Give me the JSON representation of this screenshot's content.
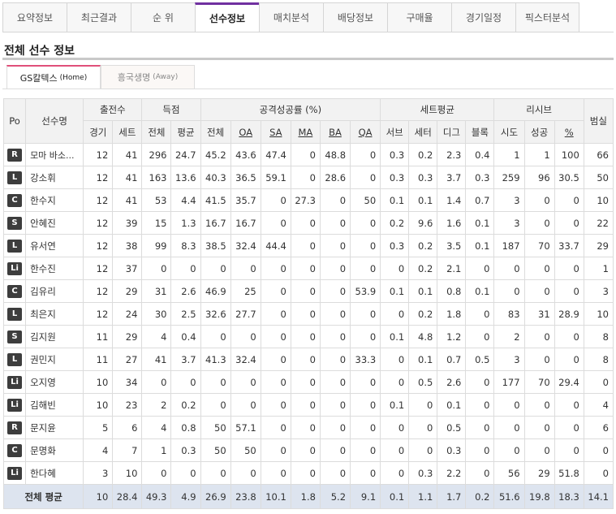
{
  "nav": {
    "tabs": [
      "요약정보",
      "최근결과",
      "순 위",
      "선수정보",
      "매치분석",
      "배당정보",
      "구매율",
      "경기일정",
      "픽스터분석"
    ],
    "active_index": 3
  },
  "section_title": "전체 선수 정보",
  "team_tabs": [
    {
      "name": "GS칼텍스",
      "side": "(Home)"
    },
    {
      "name": "흥국생명",
      "side": "(Away)"
    }
  ],
  "table": {
    "header_groups": {
      "po": "Po",
      "name": "선수명",
      "appear": "출전수",
      "score": "득점",
      "attack": "공격성공률 (%)",
      "set_avg": "세트평균",
      "receive": "리시브",
      "fault": "범실"
    },
    "sub_headers": [
      "경기",
      "세트",
      "전체",
      "평균",
      "전체",
      "OA",
      "SA",
      "MA",
      "BA",
      "QA",
      "서브",
      "세터",
      "디그",
      "블록",
      "시도",
      "성공",
      "%"
    ],
    "rows": [
      [
        "R",
        "모마 바소...",
        "12",
        "41",
        "296",
        "24.7",
        "45.2",
        "43.6",
        "47.4",
        "0",
        "48.8",
        "0",
        "0.3",
        "0.2",
        "2.3",
        "0.4",
        "1",
        "1",
        "100",
        "66"
      ],
      [
        "L",
        "강소휘",
        "12",
        "41",
        "163",
        "13.6",
        "40.3",
        "36.5",
        "59.1",
        "0",
        "28.6",
        "0",
        "0.3",
        "0.3",
        "3.7",
        "0.3",
        "259",
        "96",
        "30.5",
        "50"
      ],
      [
        "C",
        "한수지",
        "12",
        "41",
        "53",
        "4.4",
        "41.5",
        "35.7",
        "0",
        "27.3",
        "0",
        "50",
        "0.1",
        "0.1",
        "1.4",
        "0.7",
        "3",
        "0",
        "0",
        "10"
      ],
      [
        "S",
        "안혜진",
        "12",
        "39",
        "15",
        "1.3",
        "16.7",
        "16.7",
        "0",
        "0",
        "0",
        "0",
        "0.2",
        "9.6",
        "1.6",
        "0.1",
        "3",
        "0",
        "0",
        "22"
      ],
      [
        "L",
        "유서연",
        "12",
        "38",
        "99",
        "8.3",
        "38.5",
        "32.4",
        "44.4",
        "0",
        "0",
        "0",
        "0.3",
        "0.2",
        "3.5",
        "0.1",
        "187",
        "70",
        "33.7",
        "29"
      ],
      [
        "Li",
        "한수진",
        "12",
        "37",
        "0",
        "0",
        "0",
        "0",
        "0",
        "0",
        "0",
        "0",
        "0",
        "0.2",
        "2.1",
        "0",
        "0",
        "0",
        "0",
        "1"
      ],
      [
        "C",
        "김유리",
        "12",
        "29",
        "31",
        "2.6",
        "46.9",
        "25",
        "0",
        "0",
        "0",
        "53.9",
        "0.1",
        "0.1",
        "0.8",
        "0.1",
        "0",
        "0",
        "0",
        "3"
      ],
      [
        "L",
        "최은지",
        "12",
        "24",
        "30",
        "2.5",
        "32.6",
        "27.7",
        "0",
        "0",
        "0",
        "0",
        "0",
        "0.2",
        "1.8",
        "0",
        "83",
        "31",
        "28.9",
        "10"
      ],
      [
        "S",
        "김지원",
        "11",
        "29",
        "4",
        "0.4",
        "0",
        "0",
        "0",
        "0",
        "0",
        "0",
        "0.1",
        "4.8",
        "1.2",
        "0",
        "2",
        "0",
        "0",
        "8"
      ],
      [
        "L",
        "권민지",
        "11",
        "27",
        "41",
        "3.7",
        "41.3",
        "32.4",
        "0",
        "0",
        "0",
        "33.3",
        "0",
        "0.1",
        "0.7",
        "0.5",
        "3",
        "0",
        "0",
        "8"
      ],
      [
        "Li",
        "오지영",
        "10",
        "34",
        "0",
        "0",
        "0",
        "0",
        "0",
        "0",
        "0",
        "0",
        "0",
        "0.5",
        "2.6",
        "0",
        "177",
        "70",
        "29.4",
        "0"
      ],
      [
        "Li",
        "김해빈",
        "10",
        "23",
        "2",
        "0.2",
        "0",
        "0",
        "0",
        "0",
        "0",
        "0",
        "0.1",
        "0",
        "0.1",
        "0",
        "0",
        "0",
        "0",
        "4"
      ],
      [
        "R",
        "문지윤",
        "5",
        "6",
        "4",
        "0.8",
        "50",
        "57.1",
        "0",
        "0",
        "0",
        "0",
        "0",
        "0",
        "0.5",
        "0",
        "0",
        "0",
        "0",
        "6"
      ],
      [
        "C",
        "문명화",
        "4",
        "7",
        "1",
        "0.3",
        "50",
        "50",
        "0",
        "0",
        "0",
        "0",
        "0",
        "0",
        "0.3",
        "0",
        "0",
        "0",
        "0",
        "0"
      ],
      [
        "Li",
        "한다혜",
        "3",
        "10",
        "0",
        "0",
        "0",
        "0",
        "0",
        "0",
        "0",
        "0",
        "0",
        "0.3",
        "2.2",
        "0",
        "56",
        "29",
        "51.8",
        "0"
      ]
    ],
    "average": {
      "label": "전체 평균",
      "values": [
        "10",
        "28.4",
        "49.3",
        "4.9",
        "26.9",
        "23.8",
        "10.1",
        "1.8",
        "5.2",
        "9.1",
        "0.1",
        "1.1",
        "1.7",
        "0.2",
        "51.6",
        "19.8",
        "18.3",
        "14.1"
      ]
    }
  },
  "colors": {
    "nav_active_border": "#7030a0",
    "team_active_border": "#e0507a",
    "position_badge": "#3d3d3d",
    "average_row": "#dde4ef"
  }
}
